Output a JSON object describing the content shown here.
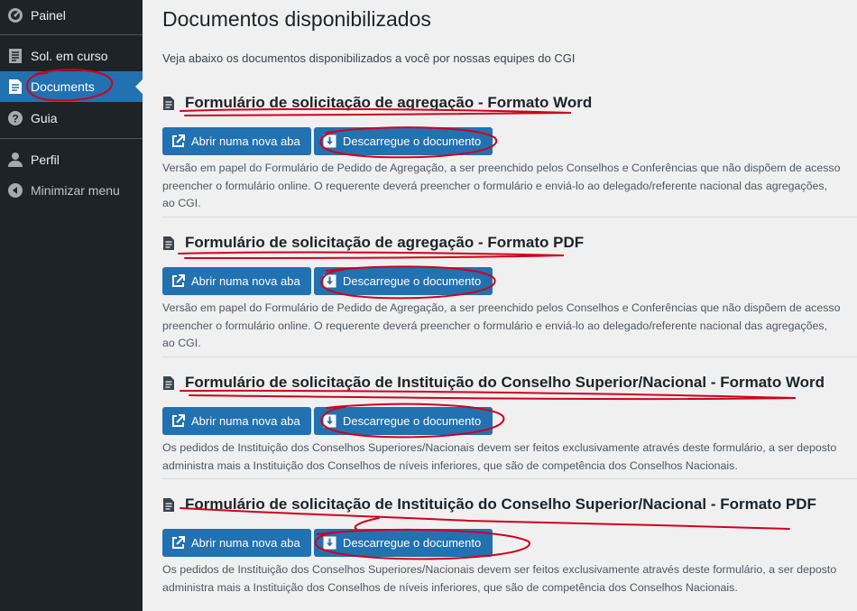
{
  "sidebar": {
    "items": [
      {
        "label": "Painel",
        "icon": "dashboard-icon"
      },
      {
        "label": "Sol. em curso",
        "icon": "document-list-icon"
      },
      {
        "label": "Documents",
        "icon": "document-icon",
        "active": true
      },
      {
        "label": "Guia",
        "icon": "help-icon"
      },
      {
        "label": "Perfil",
        "icon": "user-icon"
      },
      {
        "label": "Minimizar menu",
        "icon": "collapse-icon"
      }
    ]
  },
  "main": {
    "title": "Documentos disponibilizados",
    "intro": "Veja abaixo os documentos disponibilizados a você por nossas equipes do CGI",
    "open_label": "Abrir numa nova aba",
    "download_label": "Descarregue o documento",
    "documents": [
      {
        "title": "Formulário de solicitação de agregação - Formato Word",
        "desc": [
          "Versão em papel do Formulário de Pedido de Agregação, a ser preenchido pelos Conselhos e Conferências que não dispõem de acesso",
          "preencher o formulário online. O requerente deverá preencher o formulário e enviá-lo ao delegado/referente nacional das agregações,",
          "ao CGI."
        ]
      },
      {
        "title": "Formulário de solicitação de agregação - Formato PDF",
        "desc": [
          "Versão em papel do Formulário de Pedido de Agregação, a ser preenchido pelos Conselhos e Conferências que não dispõem de acesso",
          "preencher o formulário online. O requerente deverá preencher o formulário e enviá-lo ao delegado/referente nacional das agregações,",
          "ao CGI."
        ]
      },
      {
        "title": "Formulário de solicitação de Instituição do Conselho Superior/Nacional - Formato Word",
        "desc": [
          "Os pedidos de Instituição dos Conselhos Superiores/Nacionais devem ser feitos exclusivamente através deste formulário, a ser deposto",
          "administra mais a Instituição dos Conselhos de níveis inferiores, que são de competência dos Conselhos Nacionais."
        ]
      },
      {
        "title": "Formulário de solicitação de Instituição do Conselho Superior/Nacional - Formato PDF",
        "desc": [
          "Os pedidos de Instituição dos Conselhos Superiores/Nacionais devem ser feitos exclusivamente através deste formulário, a ser deposto",
          "administra mais a Instituição dos Conselhos de níveis inferiores, que são de competência dos Conselhos Nacionais."
        ]
      }
    ]
  },
  "colors": {
    "sidebar_bg": "#1d2327",
    "accent": "#2271b1",
    "annotation": "#d0021b"
  }
}
